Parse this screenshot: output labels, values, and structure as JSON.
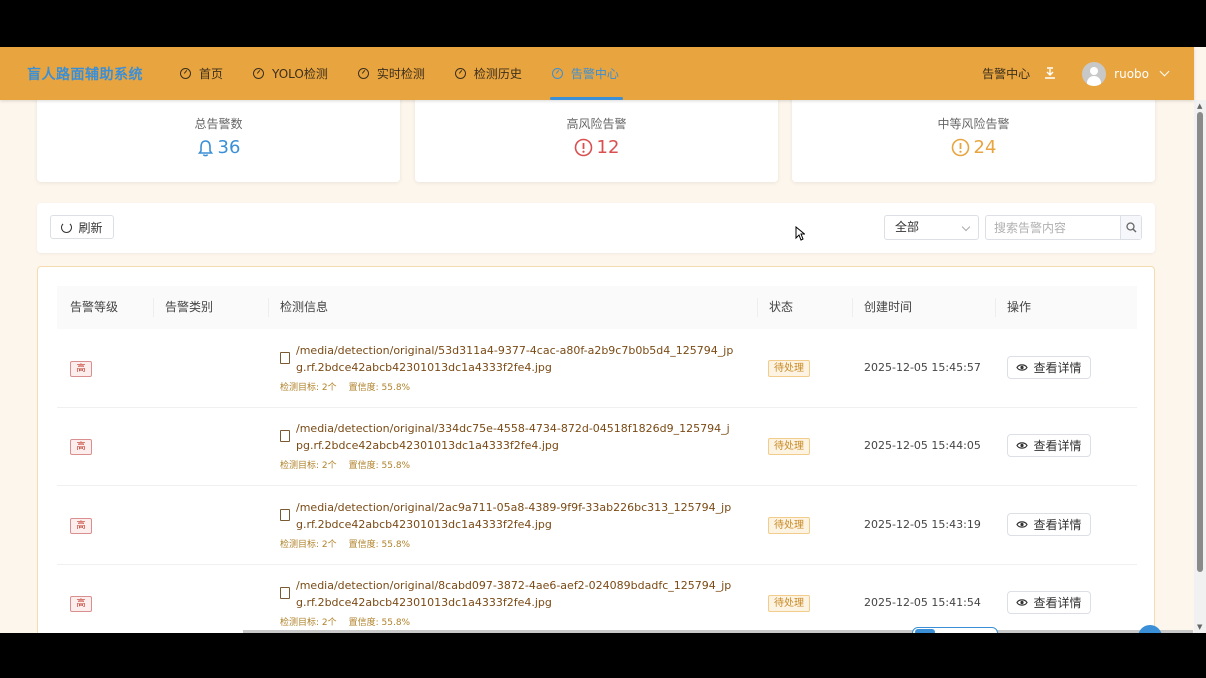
{
  "brand": "盲人路面辅助系统",
  "nav": [
    {
      "label": "首页",
      "active": false
    },
    {
      "label": "YOLO检测",
      "active": false
    },
    {
      "label": "实时检测",
      "active": false
    },
    {
      "label": "检测历史",
      "active": false
    },
    {
      "label": "告警中心",
      "active": true
    }
  ],
  "header_right": {
    "alert_label": "告警中心",
    "username": "ruobo"
  },
  "stats": [
    {
      "label": "总告警数",
      "value": "36",
      "color": "#3b8fd6",
      "icon": "bell-icon"
    },
    {
      "label": "高风险告警",
      "value": "12",
      "color": "#d94f4f",
      "icon": "alert-circle-icon"
    },
    {
      "label": "中等风险告警",
      "value": "24",
      "color": "#e8a43f",
      "icon": "alert-circle-icon"
    }
  ],
  "toolbar": {
    "refresh_label": "刷新",
    "filter_selected": "全部",
    "search_placeholder": "搜索告警内容"
  },
  "table": {
    "headers": [
      "告警等级",
      "告警类别",
      "检测信息",
      "状态",
      "创建时间",
      "操作"
    ],
    "rows": [
      {
        "level": "高",
        "path": "/media/detection/original/53d311a4-9377-4cac-a80f-a2b9c7b0b5d4_125794_jpg.rf.2bdce42abcb42301013dc1a4333f2fe4.jpg",
        "targets": "检测目标: 2个",
        "confidence": "置信度: 55.8%",
        "status": "待处理",
        "time": "2025-12-05 15:45:57",
        "action": "查看详情"
      },
      {
        "level": "高",
        "path": "/media/detection/original/334dc75e-4558-4734-872d-04518f1826d9_125794_jpg.rf.2bdce42abcb42301013dc1a4333f2fe4.jpg",
        "targets": "检测目标: 2个",
        "confidence": "置信度: 55.8%",
        "status": "待处理",
        "time": "2025-12-05 15:44:05",
        "action": "查看详情"
      },
      {
        "level": "高",
        "path": "/media/detection/original/2ac9a711-05a8-4389-9f9f-33ab226bc313_125794_jpg.rf.2bdce42abcb42301013dc1a4333f2fe4.jpg",
        "targets": "检测目标: 2个",
        "confidence": "置信度: 55.8%",
        "status": "待处理",
        "time": "2025-12-05 15:43:19",
        "action": "查看详情"
      },
      {
        "level": "高",
        "path": "/media/detection/original/8cabd097-3872-4ae6-aef2-024089bdadfc_125794_jpg.rf.2bdce42abcb42301013dc1a4333f2fe4.jpg",
        "targets": "检测目标: 2个",
        "confidence": "置信度: 55.8%",
        "status": "待处理",
        "time": "2025-12-05 15:41:54",
        "action": "查看详情"
      }
    ]
  }
}
